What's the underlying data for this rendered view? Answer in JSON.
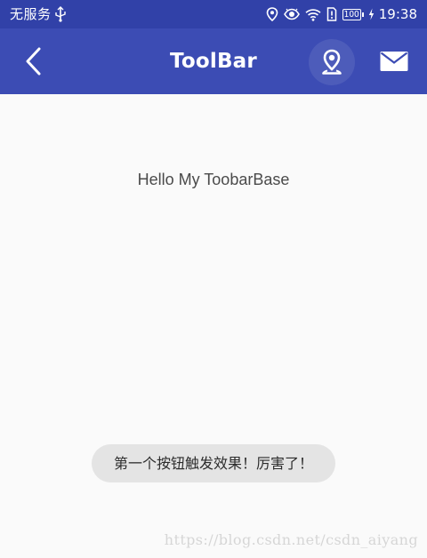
{
  "status_bar": {
    "carrier": "无服务",
    "battery": "100",
    "time": "19:38",
    "icons": [
      "usb-icon",
      "location-status-icon",
      "eye-icon",
      "wifi-icon",
      "sim-icon",
      "battery-icon",
      "charging-icon"
    ]
  },
  "toolbar": {
    "title": "ToolBar",
    "back_icon": "chevron-left-icon",
    "location_icon": "location-pin-icon",
    "mail_icon": "mail-icon",
    "background": "#3c4cb4"
  },
  "content": {
    "hello_text": "Hello My ToobarBase"
  },
  "toast": {
    "message": "第一个按钮触发效果！厉害了！"
  },
  "watermark": {
    "text": "https://blog.csdn.net/csdn_aiyang"
  }
}
